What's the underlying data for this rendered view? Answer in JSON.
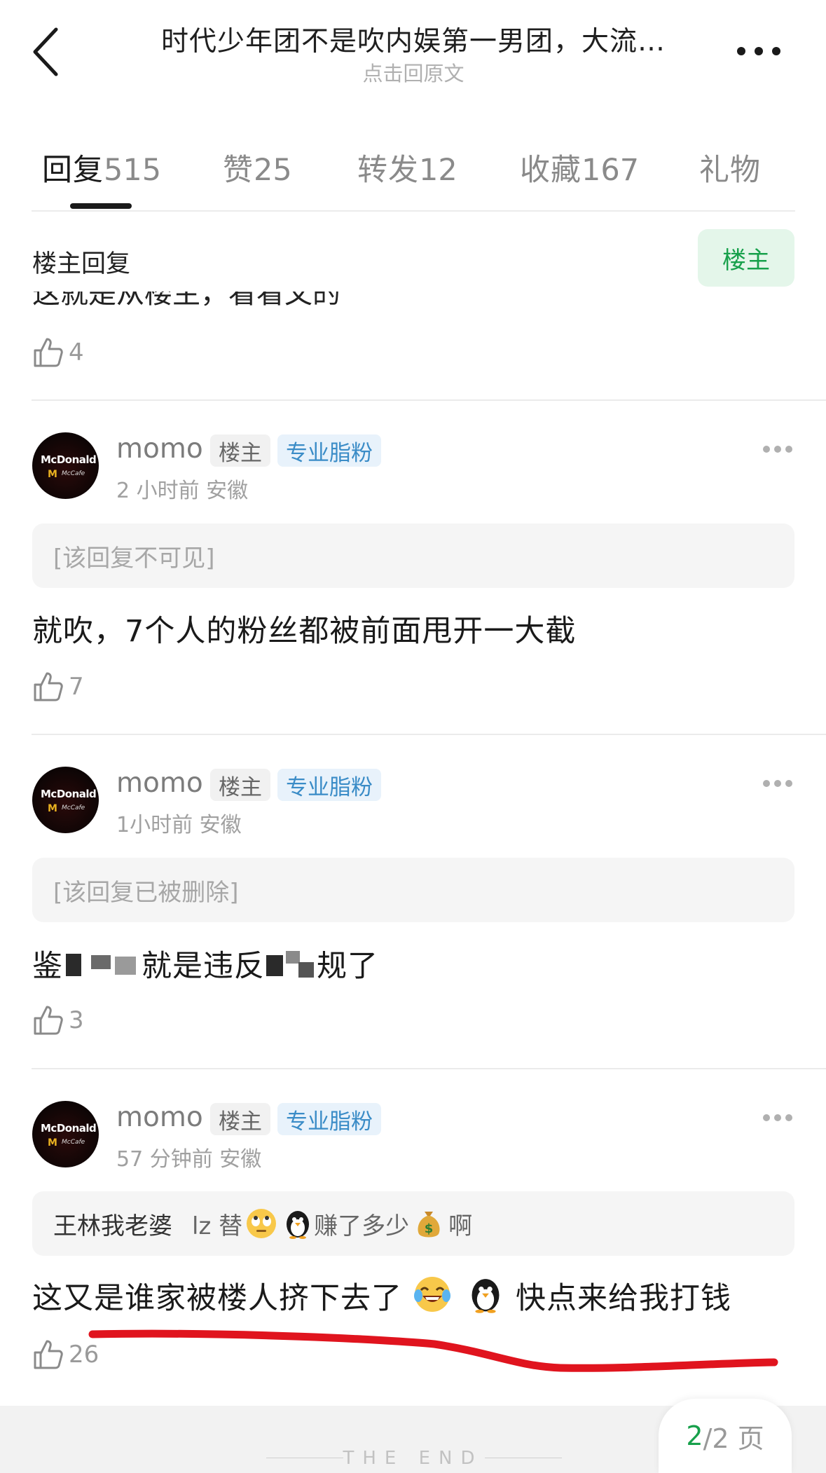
{
  "header": {
    "title": "时代少年团不是吹内娱第一男团，大流…",
    "subtitle": "点击回原文"
  },
  "tabs": [
    {
      "label": "回复",
      "count": "515"
    },
    {
      "label": "赞",
      "count": "25"
    },
    {
      "label": "转发",
      "count": "12"
    },
    {
      "label": "收藏",
      "count": "167"
    },
    {
      "label": "礼物",
      "count": ""
    }
  ],
  "owner_strip": {
    "label": "楼主回复",
    "toggle": "楼主"
  },
  "prev_comment": {
    "likes": "4"
  },
  "comments": [
    {
      "username": "momo",
      "badge_owner": "楼主",
      "badge_fan": "专业脂粉",
      "meta": "2 小时前 安徽",
      "quote": "[该回复不可见]",
      "text": "就吹，7个人的粉丝都被前面甩开一大截",
      "likes": "7"
    },
    {
      "username": "momo",
      "badge_owner": "楼主",
      "badge_fan": "专业脂粉",
      "meta": "1小时前 安徽",
      "quote": "[该回复已被删除]",
      "text_a": "鉴",
      "text_b": "就是违反",
      "text_c": "规了",
      "likes": "3"
    },
    {
      "username": "momo",
      "badge_owner": "楼主",
      "badge_fan": "专业脂粉",
      "meta": "57 分钟前 安徽",
      "quote_user": "王林我老婆",
      "quote_a": "lz 替",
      "quote_b": "赚了多少",
      "quote_c": "啊",
      "text_a": "这又是谁家被楼人挤下去了",
      "text_b": "快点来给我打钱",
      "likes": "26"
    }
  ],
  "footer": {
    "end_text": "THE END",
    "page_current": "2",
    "page_rest": "/2 页"
  },
  "icons": [
    "back-icon",
    "more-icon",
    "like-icon",
    "rolling-eyes-icon",
    "penguin-icon",
    "money-bag-icon",
    "laughing-tears-icon"
  ],
  "colors": {
    "accent_green": "#17a04b",
    "fan_blue": "#3a8cc7",
    "annotation_red": "#e0141e"
  }
}
